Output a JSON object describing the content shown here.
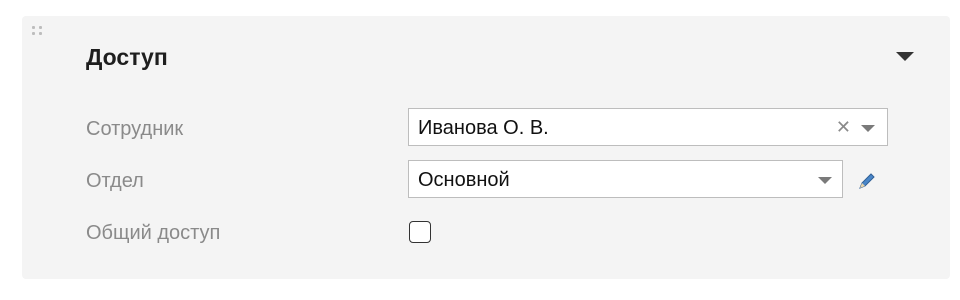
{
  "section": {
    "title": "Доступ"
  },
  "fields": {
    "employee": {
      "label": "Сотрудник",
      "value": "Иванова О. В."
    },
    "department": {
      "label": "Отдел",
      "value": "Основной"
    },
    "shared_access": {
      "label": "Общий доступ",
      "checked": false
    }
  },
  "icons": {
    "drag": "drag-handle-icon",
    "collapse": "triangle-down-icon",
    "clear": "close-icon",
    "dropdown": "chevron-down-icon",
    "edit": "pencil-icon"
  },
  "colors": {
    "panel_bg": "#f4f4f4",
    "label": "#8a8a8a",
    "border": "#bdbdbd",
    "edit_icon": "#4a86c8"
  }
}
